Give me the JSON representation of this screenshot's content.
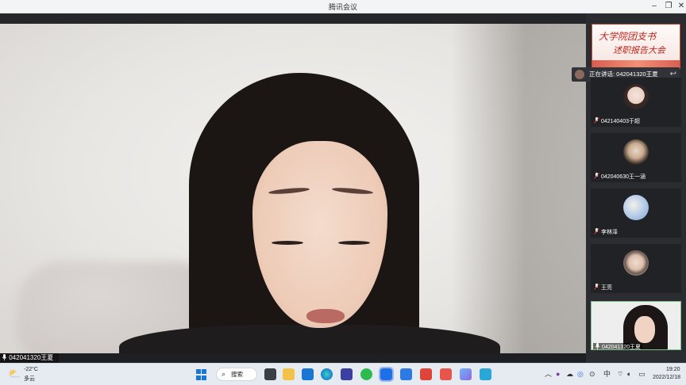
{
  "window": {
    "title": "腾讯会议",
    "min": "–",
    "max": "❐",
    "close": "✕"
  },
  "main_video": {
    "speaker_label": "042041320王夏"
  },
  "sidebar": {
    "banner": {
      "line1": "大学院团支书",
      "line2": "述职报告大会"
    },
    "talking": {
      "text": "正在讲话: 042041320王夏",
      "return_icon": "↩"
    },
    "participants": [
      {
        "name": "042140403于超"
      },
      {
        "name": "042040630王一涵"
      },
      {
        "name": "李林泽"
      },
      {
        "name": "王亮"
      },
      {
        "name": "042041320王夏"
      }
    ]
  },
  "taskbar": {
    "weather": {
      "temp": "-22°C",
      "desc": "多云",
      "icon": "partly-cloudy-icon"
    },
    "search_label": "搜索",
    "tray_lang": "中",
    "clock": {
      "time": "19:20",
      "date": "2022/12/18"
    }
  },
  "colors": {
    "accent": "#1976d2",
    "self_border": "#7bc389",
    "banner_red": "#c0251c"
  }
}
